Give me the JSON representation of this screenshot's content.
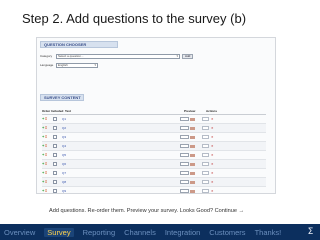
{
  "slide": {
    "title": "Step 2. Add questions to the survey (b)",
    "caption": "Add questions. Re-order them. Preview your survey. Looks Good? Continue →"
  },
  "screenshot": {
    "banner_top": "QUESTION CHOOSER",
    "banner_mid": "SURVEY CONTENT",
    "form": [
      {
        "label": "Category",
        "value": "Select a question...",
        "button": "Add"
      },
      {
        "label": "Language",
        "value": "English"
      }
    ],
    "table_headers": [
      "Order",
      "Included",
      "Text",
      "Preview",
      "Actions"
    ],
    "rows": [
      {
        "text": "Q1"
      },
      {
        "text": "Q2"
      },
      {
        "text": "Q3"
      },
      {
        "text": "Q4"
      },
      {
        "text": "Q5"
      },
      {
        "text": "Q6"
      },
      {
        "text": "Q7"
      },
      {
        "text": "Q8"
      },
      {
        "text": "Q9"
      }
    ]
  },
  "nav": {
    "items": [
      "Overview",
      "Survey",
      "Reporting",
      "Channels",
      "Integration",
      "Customers",
      "Thanks!"
    ],
    "active_index": 1,
    "logo": "Σ"
  },
  "colors": {
    "nav_bg": "#0c2f5e",
    "nav_text": "#6b8fbe",
    "nav_active": "#ffd34d"
  }
}
